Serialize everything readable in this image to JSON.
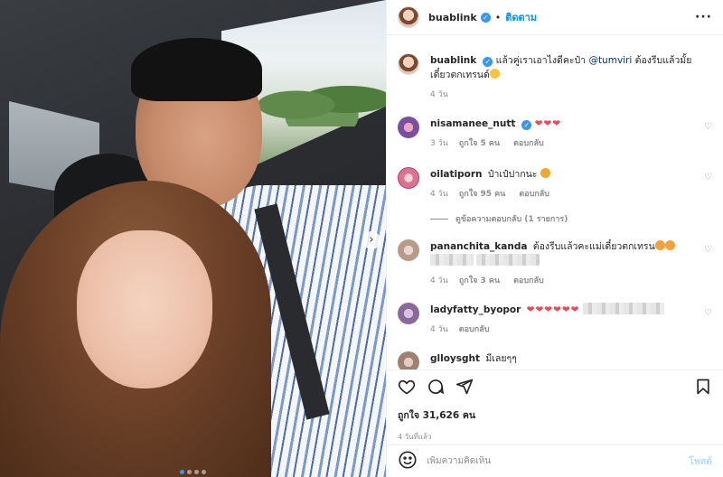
{
  "post": {
    "author": "buablink",
    "follow_label": "ติดตาม",
    "dot": "•",
    "more": "···",
    "verified_glyph": "✓"
  },
  "caption": {
    "username": "buablink",
    "text_before": "แล้วคู่เราเอาไงดีคะป๋า",
    "mention": "@tumviri",
    "text_after": "ต้องรีบแล้วมั้ยเดี๋ยวตกเทรนด์",
    "time": "4 วัน"
  },
  "comments": [
    {
      "username": "nisamanee_nutt",
      "text": "❤❤❤",
      "time": "3 วัน",
      "likes": "ถูกใจ 5 คน",
      "reply": "ตอบกลับ",
      "avatar_color": "#7b4fa0"
    },
    {
      "username": "oilatiporn",
      "text": "ป๋าเป๋ปากนะ",
      "time": "4 วัน",
      "likes": "ถูกใจ 95 คน",
      "reply": "ตอบกลับ",
      "avatar_color": "#d9748c"
    },
    {
      "username": "pananchita_kanda",
      "text": "ต้องรีบแล้วคะแม่เดี๋ยวตกเทรน",
      "time": "4 วัน",
      "likes": "ถูกใจ 3 คน",
      "reply": "ตอบกลับ",
      "avatar_color": "#b89a8a"
    },
    {
      "username": "ladyfatty_byopor",
      "text": "❤❤❤❤❤❤",
      "time": "4 วัน",
      "likes": "",
      "reply": "ตอบกลับ",
      "avatar_color": "#8a6a9a"
    },
    {
      "username": "glloysght",
      "text": "มีเลยๆๆ",
      "avatar_color": "#a08070"
    }
  ],
  "view_replies": "ดูข้อความตอบกลับ (1 รายการ)",
  "actions": {
    "likes_text": "ถูกใจ 31,626 คน",
    "time": "4 วันที่แล้ว"
  },
  "add_comment": {
    "placeholder": "เพิ่มความคิดเห็น",
    "post_label": "โพสต์"
  },
  "carousel": {
    "count": 4,
    "active": 1
  },
  "colors": {
    "accent": "#0095f6",
    "heart": "#ed4956",
    "muted": "#8e8e8e",
    "verified": "#3897f0"
  },
  "icons": [
    "heart-icon",
    "comment-icon",
    "share-icon",
    "bookmark-icon",
    "smile-icon",
    "more-icon",
    "chevron-right-icon",
    "verified-icon"
  ]
}
